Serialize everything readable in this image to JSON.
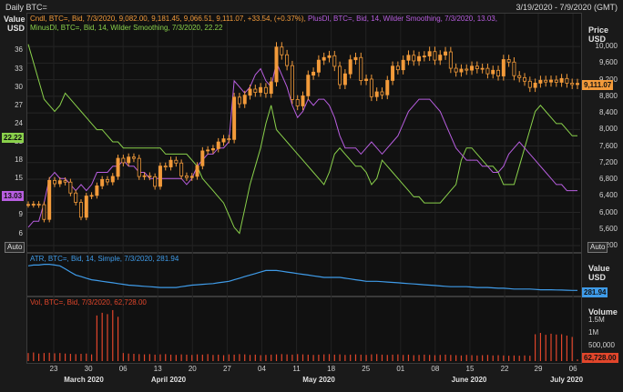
{
  "header": {
    "title": "Daily BTC=",
    "date_range": "3/19/2020 - 7/9/2020 (GMT)"
  },
  "price_pane": {
    "legend": [
      {
        "text": "Cndl, BTC=, Bid, 7/3/2020, 9,082.00, 9,181.45, 9,066.51, 9,111.07, +33.54, (+0.37%),",
        "color": "#f29a3a"
      },
      {
        "text": "PlusDI, BTC=, Bid, 14, Wilder Smoothing, 7/3/2020, 13.03,",
        "color": "#b85ee0"
      },
      {
        "text": "MinusDI, BTC=, Bid, 14, Wilder Smoothing, 7/3/2020, 22.22",
        "color": "#8ad14b"
      }
    ],
    "left_axis_title": "Value\nUSD",
    "right_axis_title": "Price\nUSD",
    "left_ticks": [
      "36",
      "33",
      "30",
      "27",
      "24",
      "21",
      "18",
      "15",
      "12",
      "9",
      "6"
    ],
    "right_ticks": [
      "10,000",
      "9,600",
      "9,200",
      "8,800",
      "8,400",
      "8,000",
      "7,600",
      "7,200",
      "6,800",
      "6,400",
      "6,000",
      "5,600",
      "5,200"
    ],
    "price_tag": "9,111.07",
    "minusdi_tag": "22.22",
    "plusdi_tag": "13.03",
    "auto_left": "Auto",
    "auto_right": "Auto"
  },
  "atr_pane": {
    "legend": "ATR, BTC=, Bid, 14, Simple, 7/3/2020, 281.94",
    "color": "#3f9be8",
    "right_axis_title": "Value\nUSD",
    "value_tag": "281.94"
  },
  "vol_pane": {
    "legend": "Vol, BTC=, Bid, 7/3/2020, 62,728.00",
    "color": "#e2462b",
    "right_axis_title": "Volume",
    "right_ticks": [
      "1.5M",
      "1M",
      "500,000"
    ],
    "value_tag": "62,728.00"
  },
  "x_axis": {
    "days": [
      "23",
      "30",
      "06",
      "13",
      "20",
      "27",
      "04",
      "11",
      "18",
      "25",
      "01",
      "08",
      "15",
      "22",
      "29",
      "06"
    ],
    "months": [
      "March 2020",
      "April 2020",
      "May 2020",
      "June 2020",
      "July 2020"
    ]
  },
  "chart_data": {
    "type": "line",
    "dates": [
      "2020-03-19",
      "2020-07-09"
    ],
    "price_ylim": [
      5200,
      10200
    ],
    "di_ylim": [
      4,
      38
    ],
    "closes": [
      6191,
      6198,
      6185,
      5831,
      6771,
      6691,
      6764,
      6730,
      6467,
      6242,
      5882,
      6395,
      6410,
      6640,
      6793,
      6735,
      6868,
      7304,
      7197,
      7334,
      7302,
      6865,
      6883,
      6858,
      6628,
      7116,
      7096,
      7257,
      7190,
      6879,
      6841,
      6869,
      7124,
      7482,
      7505,
      7538,
      7698,
      7774,
      7759,
      8778,
      8620,
      8826,
      8972,
      8894,
      9011,
      8869,
      9148,
      9986,
      9800,
      9539,
      8722,
      8567,
      8810,
      9309,
      9382,
      9671,
      9734,
      9777,
      9522,
      9081,
      9341,
      9680,
      9734,
      9179,
      9213,
      8790,
      8906,
      8835,
      9181,
      9525,
      9439,
      9668,
      9788,
      9653,
      9758,
      9771,
      9877,
      9672,
      9793,
      9870,
      9475,
      9386,
      9455,
      9430,
      9525,
      9464,
      9473,
      9342,
      9426,
      9289,
      9685,
      9624,
      9296,
      9249,
      9163,
      9012,
      9117,
      9185,
      9143,
      9190,
      9137,
      9228,
      9116,
      9082,
      9111
    ],
    "plus_di": [
      7,
      8,
      8,
      11,
      15,
      16,
      15,
      15,
      14,
      13,
      14,
      13,
      14,
      16,
      16,
      16,
      17,
      17,
      18,
      17,
      17,
      16,
      16,
      15,
      15,
      15,
      15,
      15,
      15,
      15,
      14,
      15,
      17,
      18,
      19,
      19,
      20,
      20,
      21,
      31,
      30,
      29,
      30,
      32,
      33,
      31,
      30,
      34,
      32,
      30,
      27,
      25,
      26,
      28,
      27,
      28,
      28,
      27,
      25,
      22,
      20,
      20,
      20,
      19,
      20,
      21,
      20,
      19,
      20,
      21,
      22,
      24,
      26,
      27,
      28,
      28,
      28,
      27,
      26,
      24,
      22,
      20,
      19,
      18,
      18,
      18,
      17,
      17,
      16,
      16,
      17,
      19,
      20,
      21,
      20,
      19,
      18,
      17,
      16,
      15,
      14,
      14,
      13,
      13,
      13
    ],
    "minus_di": [
      37,
      34,
      31,
      28,
      27,
      26,
      27,
      29,
      28,
      27,
      26,
      25,
      24,
      23,
      23,
      22,
      21,
      21,
      20,
      20,
      20,
      20,
      20,
      20,
      20,
      20,
      19,
      19,
      19,
      19,
      19,
      18,
      17,
      15,
      14,
      13,
      12,
      11,
      9,
      7,
      6,
      10,
      14,
      17,
      20,
      24,
      27,
      23,
      22,
      21,
      20,
      19,
      18,
      17,
      16,
      15,
      14,
      16,
      19,
      20,
      19,
      18,
      17,
      17,
      16,
      14,
      15,
      18,
      17,
      16,
      15,
      14,
      13,
      12,
      12,
      11,
      11,
      11,
      11,
      12,
      13,
      14,
      18,
      20,
      20,
      19,
      18,
      17,
      17,
      16,
      14,
      14,
      14,
      17,
      20,
      23,
      26,
      27,
      26,
      25,
      24,
      24,
      23,
      22,
      22
    ],
    "atr": [
      600,
      610,
      610,
      620,
      620,
      610,
      600,
      560,
      520,
      480,
      460,
      440,
      420,
      410,
      400,
      390,
      380,
      370,
      360,
      350,
      345,
      340,
      335,
      330,
      325,
      320,
      320,
      320,
      320,
      330,
      340,
      350,
      355,
      360,
      365,
      370,
      380,
      390,
      400,
      420,
      440,
      460,
      480,
      500,
      520,
      540,
      540,
      540,
      530,
      520,
      510,
      500,
      490,
      480,
      470,
      460,
      450,
      450,
      450,
      450,
      440,
      430,
      420,
      410,
      400,
      400,
      400,
      395,
      390,
      385,
      380,
      375,
      370,
      365,
      360,
      355,
      350,
      345,
      340,
      335,
      330,
      330,
      330,
      330,
      325,
      320,
      320,
      320,
      315,
      310,
      310,
      305,
      300,
      300,
      300,
      300,
      295,
      290,
      290,
      290,
      288,
      286,
      284,
      282,
      281.94
    ],
    "volume": [
      300000,
      320000,
      280000,
      300000,
      310000,
      290000,
      300000,
      280000,
      270000,
      260000,
      270000,
      280000,
      250000,
      1700000,
      1800000,
      1750000,
      1900000,
      1650000,
      300000,
      280000,
      270000,
      260000,
      250000,
      260000,
      240000,
      250000,
      260000,
      240000,
      230000,
      250000,
      240000,
      230000,
      250000,
      240000,
      260000,
      230000,
      240000,
      220000,
      250000,
      240000,
      260000,
      250000,
      230000,
      240000,
      220000,
      230000,
      240000,
      250000,
      260000,
      250000,
      240000,
      260000,
      250000,
      240000,
      230000,
      240000,
      250000,
      260000,
      240000,
      250000,
      230000,
      240000,
      250000,
      240000,
      230000,
      250000,
      260000,
      240000,
      230000,
      240000,
      250000,
      230000,
      240000,
      220000,
      230000,
      240000,
      230000,
      220000,
      230000,
      240000,
      230000,
      220000,
      210000,
      230000,
      220000,
      210000,
      220000,
      230000,
      210000,
      220000,
      210000,
      200000,
      210000,
      200000,
      210000,
      200000,
      1000000,
      1050000,
      980000,
      1020000,
      990000,
      1000000,
      950000,
      900000,
      62728
    ]
  }
}
